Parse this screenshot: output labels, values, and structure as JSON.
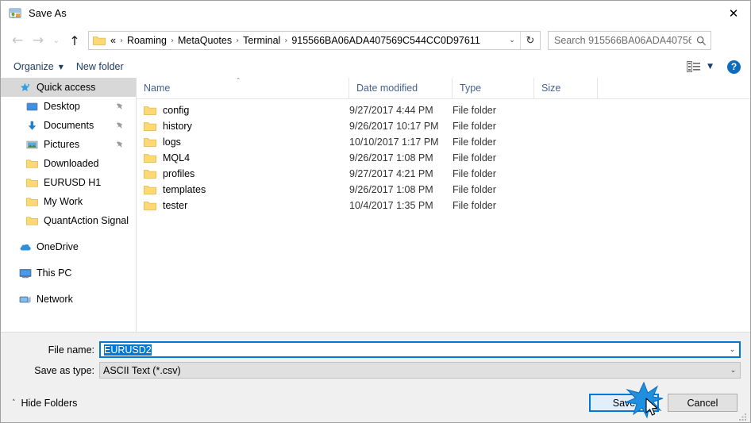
{
  "window": {
    "title": "Save As",
    "icon": "save-as-icon",
    "close_label": "✕"
  },
  "navigation": {
    "back_label": "←",
    "forward_label": "→",
    "recent_label": "⌄",
    "up_label": "↑",
    "refresh_label": "↻",
    "dropdown_label": "⌄",
    "breadcrumbs": [
      {
        "label": "«"
      },
      {
        "label": "Roaming"
      },
      {
        "label": "MetaQuotes"
      },
      {
        "label": "Terminal"
      },
      {
        "label": "915566BA06ADA407569C544CC0D97611"
      }
    ],
    "separator": "›"
  },
  "search": {
    "placeholder": "Search 915566BA06ADA40756...",
    "icon": "search-icon"
  },
  "toolbar": {
    "organize_label": "Organize",
    "organize_caret": "▼",
    "new_folder_label": "New folder",
    "view_icon": "list-view-icon",
    "view_caret": "▼",
    "help_label": "?"
  },
  "sidebar": {
    "items": [
      {
        "label": "Quick access",
        "icon": "star-pin-icon",
        "level": 0,
        "selected": true,
        "pinned": false
      },
      {
        "label": "Desktop",
        "icon": "desktop-icon",
        "level": 1,
        "selected": false,
        "pinned": true
      },
      {
        "label": "Documents",
        "icon": "documents-download-icon",
        "level": 1,
        "selected": false,
        "pinned": true
      },
      {
        "label": "Pictures",
        "icon": "pictures-icon",
        "level": 1,
        "selected": false,
        "pinned": true
      },
      {
        "label": "Downloaded",
        "icon": "folder-icon",
        "level": 1,
        "selected": false,
        "pinned": false
      },
      {
        "label": "EURUSD H1",
        "icon": "folder-icon",
        "level": 1,
        "selected": false,
        "pinned": false
      },
      {
        "label": "My Work",
        "icon": "folder-icon",
        "level": 1,
        "selected": false,
        "pinned": false
      },
      {
        "label": "QuantAction Signal",
        "icon": "folder-icon",
        "level": 1,
        "selected": false,
        "pinned": false
      },
      {
        "label": "",
        "icon": "gap",
        "level": 0,
        "selected": false,
        "pinned": false
      },
      {
        "label": "OneDrive",
        "icon": "onedrive-icon",
        "level": 0,
        "selected": false,
        "pinned": false
      },
      {
        "label": "",
        "icon": "gap",
        "level": 0,
        "selected": false,
        "pinned": false
      },
      {
        "label": "This PC",
        "icon": "this-pc-icon",
        "level": 0,
        "selected": false,
        "pinned": false
      },
      {
        "label": "",
        "icon": "gap",
        "level": 0,
        "selected": false,
        "pinned": false
      },
      {
        "label": "Network",
        "icon": "network-icon",
        "level": 0,
        "selected": false,
        "pinned": false
      }
    ]
  },
  "filelist": {
    "columns": [
      "Name",
      "Date modified",
      "Type",
      "Size"
    ],
    "sort_indicator": "˄",
    "rows": [
      {
        "name": "config",
        "date": "9/27/2017 4:44 PM",
        "type": "File folder",
        "size": ""
      },
      {
        "name": "history",
        "date": "9/26/2017 10:17 PM",
        "type": "File folder",
        "size": ""
      },
      {
        "name": "logs",
        "date": "10/10/2017 1:17 PM",
        "type": "File folder",
        "size": ""
      },
      {
        "name": "MQL4",
        "date": "9/26/2017 1:08 PM",
        "type": "File folder",
        "size": ""
      },
      {
        "name": "profiles",
        "date": "9/27/2017 4:21 PM",
        "type": "File folder",
        "size": ""
      },
      {
        "name": "templates",
        "date": "9/26/2017 1:08 PM",
        "type": "File folder",
        "size": ""
      },
      {
        "name": "tester",
        "date": "10/4/2017 1:35 PM",
        "type": "File folder",
        "size": ""
      }
    ]
  },
  "form": {
    "filename_label": "File name:",
    "filename_value": "EURUSD2",
    "filetype_label": "Save as type:",
    "filetype_value": "ASCII Text (*.csv)",
    "combo_arrow": "⌄"
  },
  "footer": {
    "hide_folders_label": "Hide Folders",
    "hide_folders_caret": "˄",
    "save_label": "Save",
    "cancel_label": "Cancel"
  },
  "colors": {
    "accent": "#0078d7",
    "folder_yellow": "#fcd975",
    "header_text": "#46618e",
    "selection_grey": "#d8d8d8"
  }
}
